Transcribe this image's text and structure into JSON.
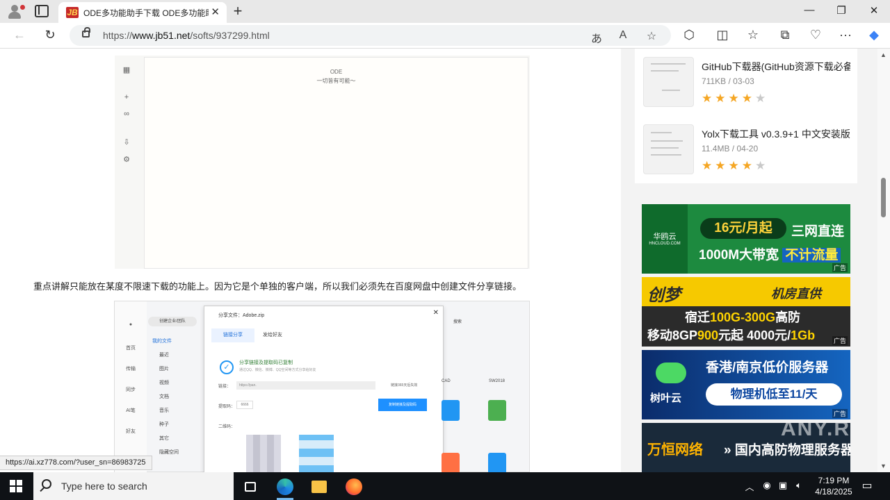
{
  "browser": {
    "tab_title": "ODE多功能助手下载 ODE多功能助",
    "url_prefix": "https://",
    "url_domain": "www.jb51.net",
    "url_path": "/softs/937299.html",
    "status_url": "https://ai.xz778.com/?user_sn=86983725"
  },
  "article": {
    "shot1_title": "ODE",
    "shot1_subtitle": "一切皆有可能～",
    "paragraph": "重点讲解只能放在某度不限速下载的功能上。因为它是个单独的客户端，所以我们必须先在百度网盘中创建文件分享链接。",
    "shot2": {
      "top_button": "创建企业/团队",
      "nav_header": "我的文件",
      "nav_items": [
        "最近",
        "图片",
        "视频",
        "文档",
        "音乐",
        "种子",
        "其它",
        "隐藏空间"
      ],
      "left_icons": [
        "首页",
        "传输",
        "同步",
        "AI笔",
        "好友"
      ],
      "dialog_title": "分享文件：Adobe.zip",
      "dialog_tab_active": "链接分享",
      "dialog_tab_other": "发给好友",
      "success_text": "分享链接及提取码已复制",
      "success_sub": "通过QQ、微信、微博、QQ空间等方式分享给好友",
      "link_label": "链接：",
      "link_value": "https://pan.",
      "valid_text": "链接365天后失效",
      "code_label": "提取码：",
      "code_value": "6666",
      "copy_button": "复制链接及提取码",
      "qr_label": "二维码：",
      "col_cad": "CAD",
      "col_sw": "SW2018",
      "search_label": "搜索"
    }
  },
  "sidebar": {
    "software": [
      {
        "name": "GitHub下载器(GitHub资源下载必备)",
        "meta": "711KB / 03-03",
        "rating": 4,
        "max": 5
      },
      {
        "name": "Yolx下载工具 v0.3.9+1 中文安装版",
        "meta": "11.4MB / 04-20",
        "rating": 4,
        "max": 5
      }
    ],
    "ads": {
      "ad_tag": "广告",
      "ad1": {
        "brand": "华鸥云",
        "brand_sub": "HNCLOUD.COM",
        "price": "16元/月起",
        "line1": "三网直连",
        "line2": "1000M大带宽",
        "line2_hl": "不计流量"
      },
      "ad2": {
        "brand": "创梦",
        "sub": "机房直供",
        "line1_a": "宿迁",
        "line1_hl": "100G-300G",
        "line1_b": "高防",
        "line2_a": "移动8GP",
        "line2_hl1": "900",
        "line2_b": "元起 4000元/",
        "line2_hl2": "1Gb"
      },
      "ad3": {
        "name": "树叶云",
        "headline": "香港/南京低价服务器",
        "pill": "物理机低至11/天"
      },
      "ad4": {
        "brand": "万恒网络",
        "text": "» 国内高防物理服务器",
        "watermark": "ANY.RUN"
      }
    }
  },
  "taskbar": {
    "search_placeholder": "Type here to search",
    "time": "7:19 PM",
    "date": "4/18/2025"
  },
  "colors": {
    "accent": "#1e6fd9",
    "star": "#f5a623",
    "taskbar": "#0f1216"
  }
}
